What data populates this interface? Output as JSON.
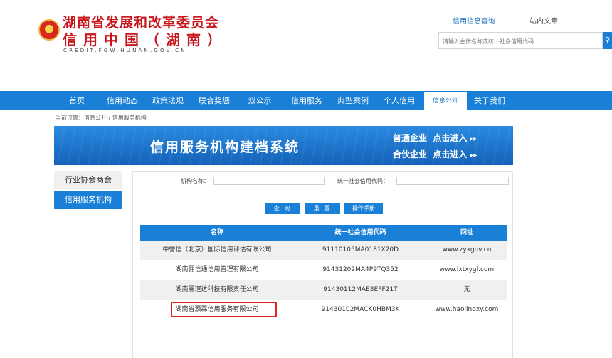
{
  "header": {
    "org_name": "湖南省发展和改革委员会",
    "site_name": "信用中国（湖南）",
    "domain_text": "CREDIT.FGW.HUNAN.GOV.CN",
    "top_links": [
      "信用信息查询",
      "站内文章"
    ],
    "search": {
      "placeholder": "请输入主体名称或统一社会信用代码",
      "button_icon": "search-icon"
    }
  },
  "nav": {
    "items": [
      "首页",
      "信用动态",
      "政策法规",
      "联合奖惩",
      "双公示",
      "信用服务",
      "典型案例",
      "个人信用",
      "信息公开",
      "关于我们"
    ],
    "active": "信息公开"
  },
  "breadcrumb": "当前位置：信息公开 / 信用服务机构",
  "banner": {
    "title": "信用服务机构建档系统",
    "links": [
      "普通企业  点击进入",
      "合伙企业  点击进入"
    ],
    "arrow": "▸▸"
  },
  "sidebar": {
    "items": [
      "行业协会商会",
      "信用服务机构"
    ],
    "active": "信用服务机构"
  },
  "form": {
    "name_label": "机构名称：",
    "code_label": "统一社会信用代码：",
    "name_value": "",
    "code_value": "",
    "buttons": [
      "查 询",
      "重 置",
      "操作手册"
    ]
  },
  "table": {
    "headers": [
      "名称",
      "统一社会信用代码",
      "网址"
    ],
    "rows": [
      [
        "中誉信（北京）国际信用评估有限公司",
        "91110105MA0181X20D",
        "www.zyxgov.cn"
      ],
      [
        "湖南翾信通信用管理有限公司",
        "91431202MA4P9TQ352",
        "www.lxtxygl.com"
      ],
      [
        "湖南麗瑄达科技有限责任公司",
        "91430112MAE3EPF21T",
        "无"
      ],
      [
        "湖南省灏霖信用服务有限公司",
        "91430102MACK0HBM3K",
        "www.haolingxy.com"
      ]
    ]
  },
  "colors": {
    "brand_red": "#c8161d",
    "primary_blue": "#1a7fd6",
    "highlight_red": "#e52222"
  }
}
